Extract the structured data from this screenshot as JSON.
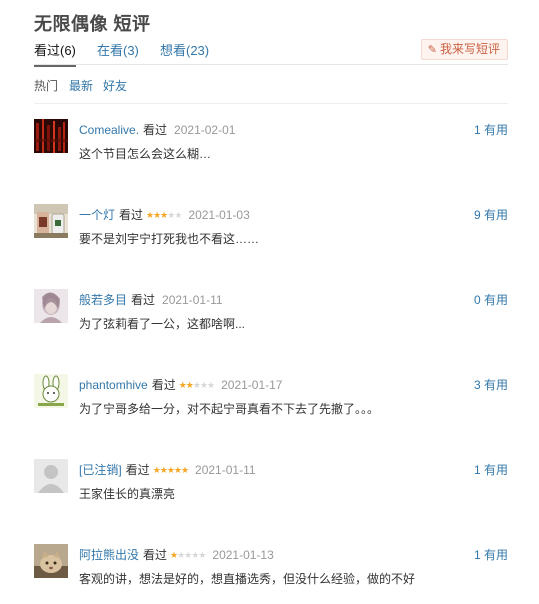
{
  "page": {
    "title": "无限偶像 短评"
  },
  "tabs": [
    {
      "label": "看过(6)"
    },
    {
      "label": "在看(3)"
    },
    {
      "label": "想看(23)"
    }
  ],
  "write_button": {
    "icon": "pencil-icon",
    "label": "我来写短评"
  },
  "sorts": [
    {
      "label": "热门"
    },
    {
      "label": "最新"
    },
    {
      "label": "好友"
    }
  ],
  "comments": [
    {
      "user": "Comealive.",
      "status": "看过",
      "rating": null,
      "date": "2021-02-01",
      "useful": "1 有用",
      "text": "这个节目怎么会这么糊…"
    },
    {
      "user": "一个灯",
      "status": "看过",
      "rating": 3,
      "date": "2021-01-03",
      "useful": "9 有用",
      "text": "要不是刘宇宁打死我也不看这……"
    },
    {
      "user": "般若多目",
      "status": "看过",
      "rating": null,
      "date": "2021-01-11",
      "useful": "0 有用",
      "text": "为了弦莉看了一公，这都啥啊..."
    },
    {
      "user": "phantomhive",
      "status": "看过",
      "rating": 2,
      "date": "2021-01-17",
      "useful": "3 有用",
      "text": "为了宁哥多给一分，对不起宁哥真看不下去了先撤了。。。"
    },
    {
      "user": "[已注销]",
      "status": "看过",
      "rating": 5,
      "date": "2021-01-11",
      "useful": "1 有用",
      "text": "王家佳长的真漂亮"
    },
    {
      "user": "阿拉熊出没",
      "status": "看过",
      "rating": 1,
      "date": "2021-01-13",
      "useful": "1 有用",
      "text": "客观的讲，想法是好的，想直播选秀，但没什么经验，做的不好"
    }
  ],
  "colors": {
    "link": "#3377aa",
    "star_on": "#f5a623",
    "star_off": "#d8d8d8",
    "date": "#999999",
    "write_button_bg": "#fff3ef",
    "write_button_text": "#c86040"
  }
}
